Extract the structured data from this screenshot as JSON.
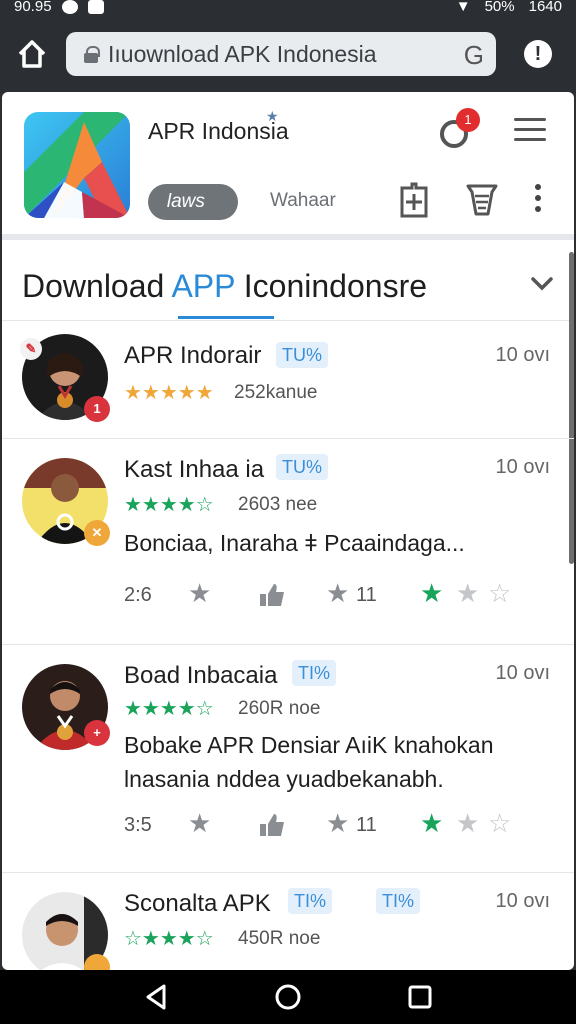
{
  "status_bar": {
    "time_left": "90.95",
    "battery": "50%",
    "clock": "1640"
  },
  "browser": {
    "url": "Iıuownload APK Indonesia",
    "reload_glyph": "G",
    "alert_glyph": "!"
  },
  "app": {
    "title": "APR Indonsia",
    "notification_count": "1",
    "tabs": [
      {
        "label": "lawsٔ",
        "active": true
      },
      {
        "label": "Wahaar",
        "active": false
      }
    ]
  },
  "section": {
    "title_pre": "Download ",
    "title_accent": "APP",
    "title_post": " Iconindonsre"
  },
  "colors": {
    "accent": "#2a8ad8",
    "star_green": "#1aa35a",
    "star_orange": "#f0a73a",
    "badge_red": "#d9343d",
    "badge_orange": "#f0a73a"
  },
  "items": [
    {
      "name": "APR Indorair",
      "tag": "TU%",
      "time": "10 ovı",
      "stars": "★★★★★",
      "star_color": "orange",
      "count": "252kanue",
      "avatar_badge": "1"
    },
    {
      "name": "Kast Inhaa ia",
      "tag": "TU%",
      "time": "10 ovı",
      "stars": "★★★★☆",
      "star_color": "green",
      "count": "2603 nee",
      "desc": "Bonciaa, Inaraha ǂ Pcaaindaga...",
      "stat_left": "2:6",
      "stat_mid": "11"
    },
    {
      "name": "Boad Inbacaia",
      "tag": "TI%",
      "time": "10 ovı",
      "stars": "★★★★☆",
      "star_color": "green",
      "count": "260R noe",
      "desc_line1": "Bobake APR Densiar AıiK knahokan",
      "desc_line2": "lnasania nddea yuadbekanabh.",
      "stat_left": "3:5",
      "stat_mid": "11"
    },
    {
      "name": "Sconalta APK",
      "tag": "TI%",
      "tag2": "TI%",
      "time": "10 ovı",
      "stars": "☆★★★☆",
      "star_color": "green",
      "count": "450R noe"
    }
  ]
}
